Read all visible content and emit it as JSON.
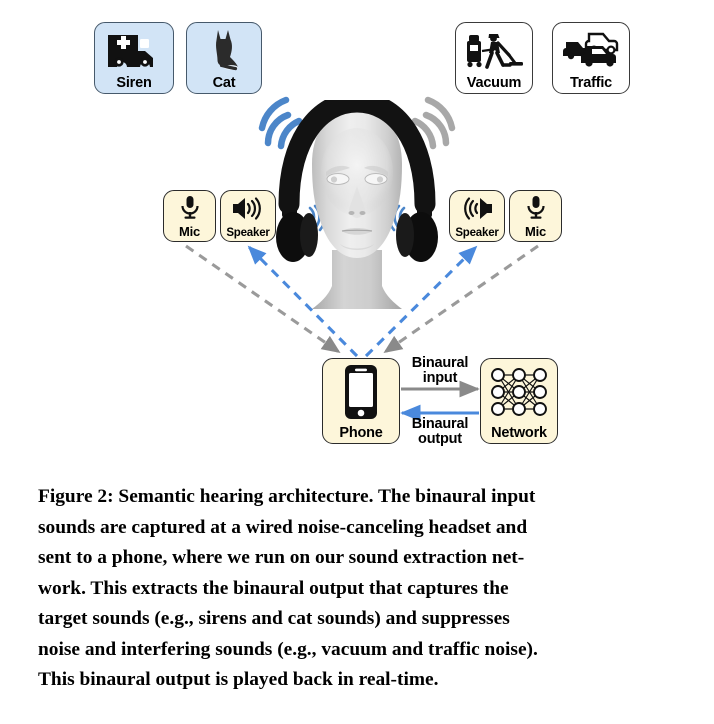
{
  "figure": {
    "id": "figure-2",
    "sound_sources": {
      "target": [
        {
          "id": "siren",
          "label": "Siren",
          "icon": "ambulance-icon",
          "style": "blue",
          "category": "target"
        },
        {
          "id": "cat",
          "label": "Cat",
          "icon": "cat-icon",
          "style": "blue",
          "category": "target"
        }
      ],
      "interfering": [
        {
          "id": "vacuum",
          "label": "Vacuum",
          "icon": "vacuum-cleaner-icon",
          "style": "white",
          "category": "noise"
        },
        {
          "id": "traffic",
          "label": "Traffic",
          "icon": "cars-icon",
          "style": "white",
          "category": "noise"
        }
      ]
    },
    "headset": {
      "device": "wired noise-canceling headset",
      "left": [
        {
          "id": "mic-left",
          "label": "Mic",
          "icon": "microphone-icon",
          "style": "cream"
        },
        {
          "id": "speaker-left",
          "label": "Speaker",
          "icon": "speaker-icon",
          "style": "cream"
        }
      ],
      "right": [
        {
          "id": "speaker-right",
          "label": "Speaker",
          "icon": "speaker-icon-mirrored",
          "style": "cream"
        },
        {
          "id": "mic-right",
          "label": "Mic",
          "icon": "microphone-icon",
          "style": "cream"
        }
      ],
      "head_illustration": "mannequin-head-with-headphones"
    },
    "compute": {
      "phone": {
        "id": "phone",
        "label": "Phone",
        "icon": "smartphone-icon",
        "style": "cream"
      },
      "network": {
        "id": "network",
        "label": "Network",
        "icon": "neural-network-icon",
        "style": "cream"
      }
    },
    "flows": [
      {
        "id": "binaural-input",
        "line1": "Binaural",
        "line2": "input",
        "direction": "phone-to-network",
        "color": "#8a8a8a"
      },
      {
        "id": "binaural-output",
        "line1": "Binaural",
        "line2": "output",
        "direction": "network-to-phone",
        "color": "#4a89dc"
      }
    ],
    "colors": {
      "target_chip_bg": "#d2e4f6",
      "noise_chip_bg": "#ffffff",
      "device_chip_bg": "#fdf6da",
      "target_wave": "#4c86c9",
      "noise_wave": "#a8a8a8",
      "input_arrow": "#8a8a8a",
      "output_arrow": "#4a89dc",
      "outline": "#2b2b2b"
    },
    "neural_network": {
      "layers": [
        3,
        3,
        3
      ],
      "fully_connected": true
    }
  },
  "caption": {
    "lines": [
      "Figure 2: Semantic hearing architecture. The binaural input",
      "sounds are captured at a wired noise-canceling headset and",
      "sent to a phone, where we run on our sound extraction net-",
      "work. This extracts the binaural output that captures the",
      "target sounds (e.g., sirens and cat sounds) and suppresses",
      "noise and interfering sounds (e.g., vacuum and traffic noise).",
      "This binaural output is played back in real-time."
    ],
    "full_text": "Figure 2: Semantic hearing architecture. The binaural input sounds are captured at a wired noise-canceling headset and sent to a phone, where we run on our sound extraction network. This extracts the binaural output that captures the target sounds (e.g., sirens and cat sounds) and suppresses noise and interfering sounds (e.g., vacuum and traffic noise). This binaural output is played back in real-time."
  }
}
